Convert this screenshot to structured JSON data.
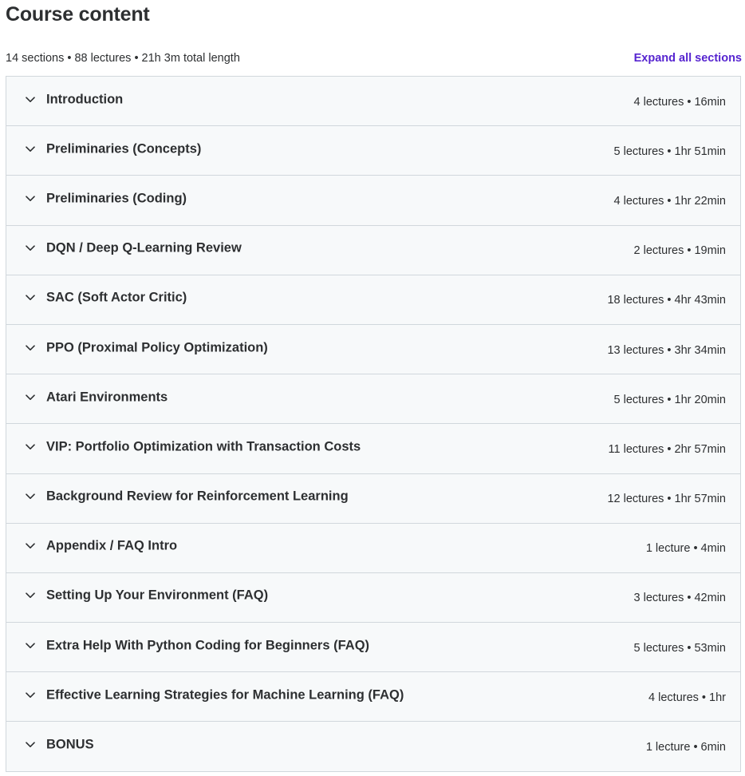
{
  "header": {
    "title": "Course content",
    "summary": "14 sections • 88 lectures • 21h 3m total length",
    "expand_label": "Expand all sections"
  },
  "icons": {
    "section_toggle": "chevron-down-icon"
  },
  "colors": {
    "link": "#5624d0",
    "section_bg": "#f7f9fa",
    "border": "#d1d7dc",
    "text": "#2d2f31"
  },
  "sections": [
    {
      "title": "Introduction",
      "meta": "4 lectures • 16min"
    },
    {
      "title": "Preliminaries (Concepts)",
      "meta": "5 lectures • 1hr 51min"
    },
    {
      "title": "Preliminaries (Coding)",
      "meta": "4 lectures • 1hr 22min"
    },
    {
      "title": "DQN / Deep Q-Learning Review",
      "meta": "2 lectures • 19min"
    },
    {
      "title": "SAC (Soft Actor Critic)",
      "meta": "18 lectures • 4hr 43min"
    },
    {
      "title": "PPO (Proximal Policy Optimization)",
      "meta": "13 lectures • 3hr 34min"
    },
    {
      "title": "Atari Environments",
      "meta": "5 lectures • 1hr 20min"
    },
    {
      "title": "VIP: Portfolio Optimization with Transaction Costs",
      "meta": "11 lectures • 2hr 57min"
    },
    {
      "title": "Background Review for Reinforcement Learning",
      "meta": "12 lectures • 1hr 57min"
    },
    {
      "title": "Appendix / FAQ Intro",
      "meta": "1 lecture • 4min"
    },
    {
      "title": "Setting Up Your Environment (FAQ)",
      "meta": "3 lectures • 42min"
    },
    {
      "title": "Extra Help With Python Coding for Beginners (FAQ)",
      "meta": "5 lectures • 53min"
    },
    {
      "title": "Effective Learning Strategies for Machine Learning (FAQ)",
      "meta": "4 lectures • 1hr"
    },
    {
      "title": "BONUS",
      "meta": "1 lecture • 6min"
    }
  ]
}
